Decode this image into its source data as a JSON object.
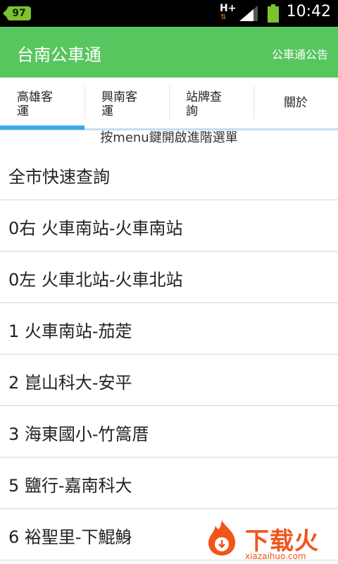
{
  "status_bar": {
    "battery_level": "97",
    "network": "H+",
    "time": "10:42"
  },
  "app_bar": {
    "title": "台南公車通",
    "announcement": "公車通公告"
  },
  "tabs": [
    {
      "label": "高雄客\n運",
      "selected": true
    },
    {
      "label": "興南客\n運",
      "selected": false
    },
    {
      "label": "站牌查\n詢",
      "selected": false
    },
    {
      "label": "關於",
      "selected": false
    }
  ],
  "hint": "按menu鍵開啟進階選單",
  "routes": [
    "全市快速查詢",
    "0右 火車南站-火車南站",
    "0左 火車北站-火車北站",
    "1 火車南站-茄萣",
    "2 崑山科大-安平",
    "3 海東國小-竹篙厝",
    "5 鹽行-嘉南科大",
    "6 裕聖里-下鯤鯓"
  ],
  "watermark": {
    "title": "下载火",
    "url": "xiazaihuo.com"
  },
  "colors": {
    "app_bar": "#57c65e",
    "tab_indicator": "#38a9e6",
    "watermark": "#f2541c"
  }
}
